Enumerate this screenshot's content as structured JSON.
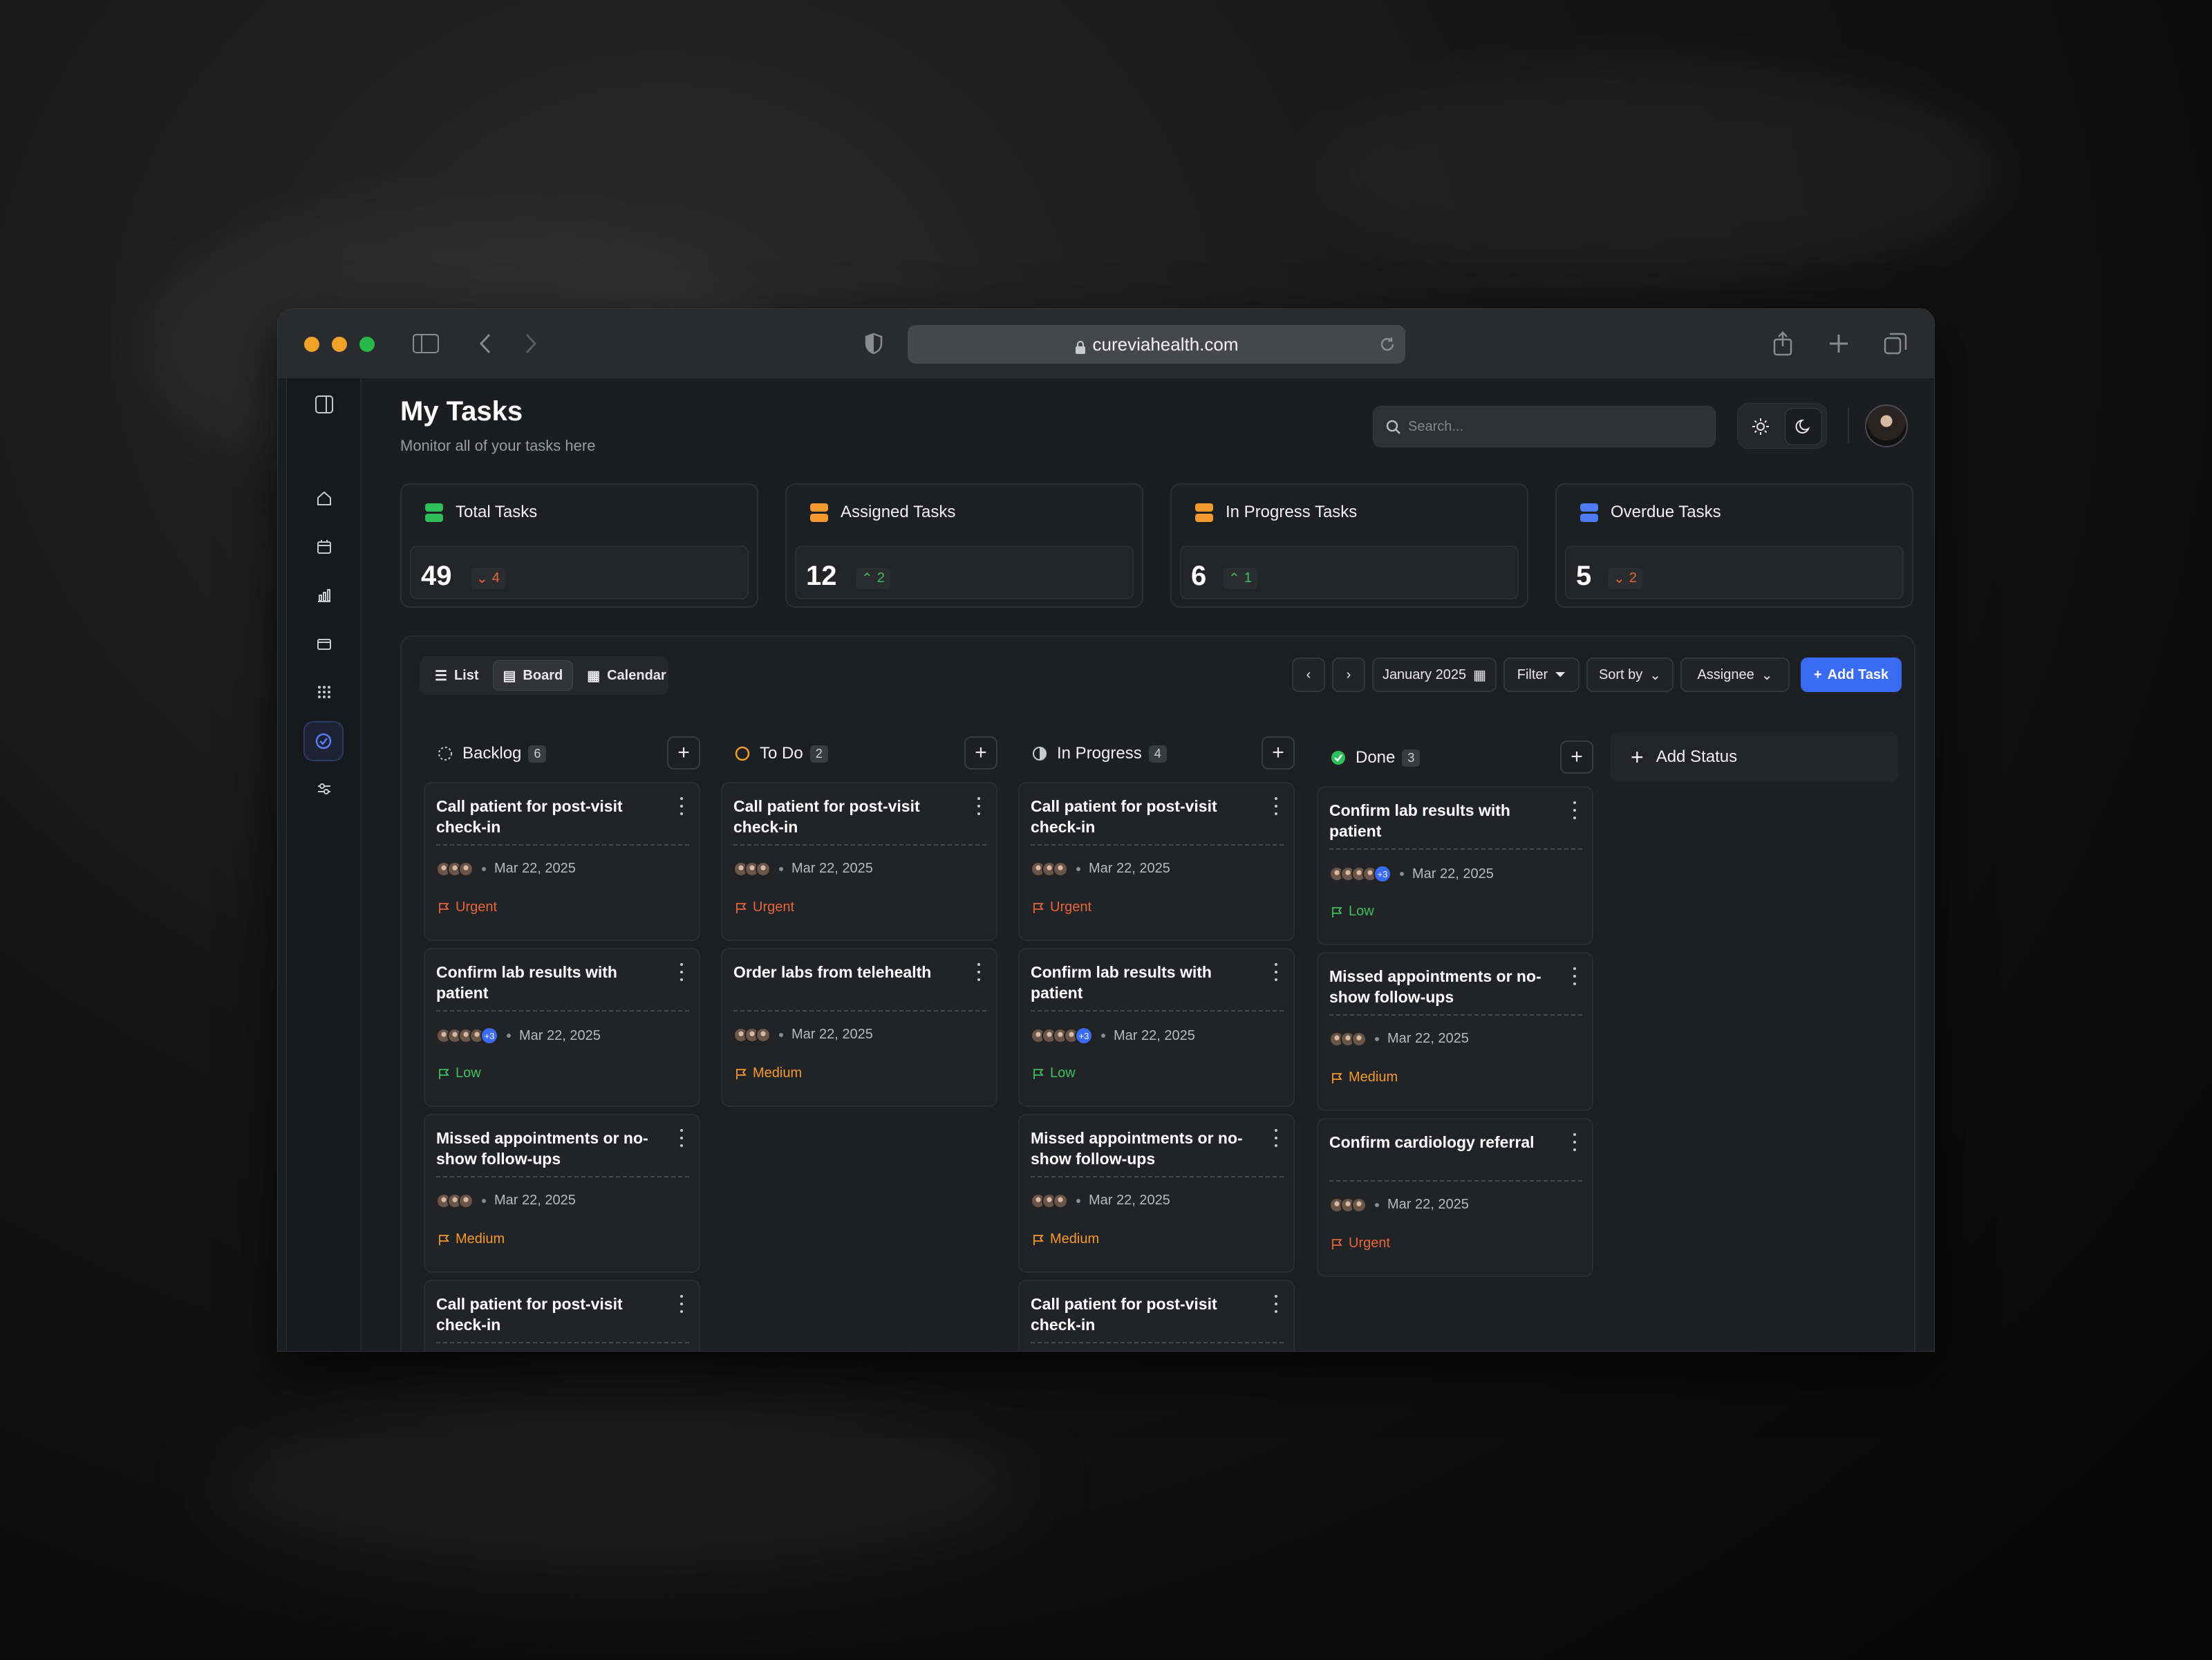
{
  "browser": {
    "url": "cureviahealth.com"
  },
  "header": {
    "title": "My Tasks",
    "subtitle": "Monitor all of your tasks here",
    "search_placeholder": "Search..."
  },
  "stats": [
    {
      "label": "Total Tasks",
      "value": "49",
      "change": "4",
      "direction": "down",
      "color": "#2fbf5a"
    },
    {
      "label": "Assigned Tasks",
      "value": "12",
      "change": "2",
      "direction": "up",
      "color": "#f29a2e"
    },
    {
      "label": "In Progress Tasks",
      "value": "6",
      "change": "1",
      "direction": "up",
      "color": "#f29a2e"
    },
    {
      "label": "Overdue Tasks",
      "value": "5",
      "change": "2",
      "direction": "down",
      "color": "#4d7cf5"
    }
  ],
  "views": {
    "list": "List",
    "board": "Board",
    "calendar": "Calendar",
    "active": "Board"
  },
  "toolbar": {
    "month": "January 2025",
    "filter": "Filter",
    "sort": "Sort by",
    "assignee": "Assignee",
    "add_task": "Add Task"
  },
  "columns": [
    {
      "name": "Backlog",
      "count": "6",
      "cards": [
        {
          "title": "Call patient for post-visit check-in",
          "date": "Mar 22, 2025",
          "priority": "Urgent",
          "extra": ""
        },
        {
          "title": "Confirm lab results with patient",
          "date": "Mar 22, 2025",
          "priority": "Low",
          "extra": "+3"
        },
        {
          "title": "Missed appointments or no-show follow-ups",
          "date": "Mar 22, 2025",
          "priority": "Medium",
          "extra": ""
        },
        {
          "title": "Call patient for post-visit check-in",
          "date": "",
          "priority": "",
          "extra": ""
        }
      ]
    },
    {
      "name": "To Do",
      "count": "2",
      "cards": [
        {
          "title": "Call patient for post-visit check-in",
          "date": "Mar 22, 2025",
          "priority": "Urgent",
          "extra": ""
        },
        {
          "title": "Order labs from telehealth",
          "date": "Mar 22, 2025",
          "priority": "Medium",
          "extra": ""
        }
      ]
    },
    {
      "name": "In Progress",
      "count": "4",
      "cards": [
        {
          "title": "Call patient for post-visit check-in",
          "date": "Mar 22, 2025",
          "priority": "Urgent",
          "extra": ""
        },
        {
          "title": "Confirm lab results with patient",
          "date": "Mar 22, 2025",
          "priority": "Low",
          "extra": "+3"
        },
        {
          "title": "Missed appointments or no-show follow-ups",
          "date": "Mar 22, 2025",
          "priority": "Medium",
          "extra": ""
        },
        {
          "title": "Call patient for post-visit check-in",
          "date": "",
          "priority": "",
          "extra": ""
        }
      ]
    },
    {
      "name": "Done",
      "count": "3",
      "cards": [
        {
          "title": "Confirm lab results with patient",
          "date": "Mar 22, 2025",
          "priority": "Low",
          "extra": "+3"
        },
        {
          "title": "Missed appointments or no-show follow-ups",
          "date": "Mar 22, 2025",
          "priority": "Medium",
          "extra": ""
        },
        {
          "title": "Confirm cardiology referral",
          "date": "Mar 22, 2025",
          "priority": "Urgent",
          "extra": ""
        }
      ]
    }
  ],
  "add_status": "Add Status",
  "priority_colors": {
    "Urgent": "#e5663d",
    "Medium": "#f29a2e",
    "Low": "#3fbf5f"
  }
}
